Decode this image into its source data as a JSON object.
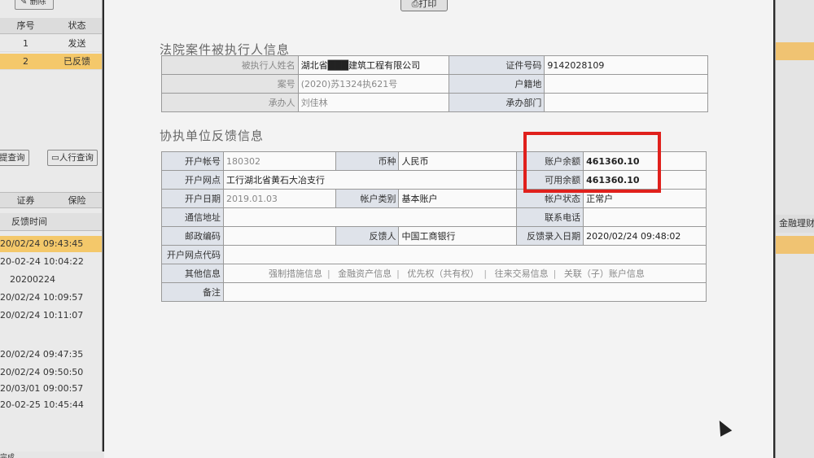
{
  "left": {
    "top_button": "删除",
    "grid_headers": [
      "序号",
      "状态"
    ],
    "grid_rows": [
      {
        "no": "1",
        "status": "发送"
      },
      {
        "no": "2",
        "status": "已反馈"
      }
    ],
    "query_buttons": [
      "提查询",
      "人行查询"
    ],
    "tabs": [
      "证券",
      "保险"
    ],
    "feedback_header": "反馈时间",
    "times": [
      "20/02/24 09:43:45",
      "20-02-24 10:04:22",
      "20200224",
      "20/02/24 10:09:57",
      "20/02/24 10:11:07",
      "20/02/24 09:47:35",
      "20/02/24 09:50:50",
      "20/03/01 09:00:57",
      "20-02-25 10:45:44"
    ]
  },
  "right": {
    "header": "金融理财"
  },
  "toolbar": {
    "print_label": "打印"
  },
  "section1": {
    "title": "法院案件被执行人信息",
    "name_label": "被执行人姓名",
    "name_value": "湖北省███建筑工程有限公司",
    "cert_label": "证件号码",
    "cert_value": "9142028109",
    "case_label": "案号",
    "case_value": "(2020)苏1324执621号",
    "household_label": "户籍地",
    "household_value": "",
    "handler_label": "承办人",
    "handler_value": "刘佳林",
    "dept_label": "承办部门",
    "dept_value": ""
  },
  "section2": {
    "title": "协执单位反馈信息",
    "account_no_label": "开户帐号",
    "account_no_value": "180302",
    "currency_label": "币种",
    "currency_value": "人民币",
    "balance_label": "账户余额",
    "balance_value": "461360.10",
    "branch_label": "开户网点",
    "branch_value": "工行湖北省黄石大冶支行",
    "available_label": "可用余额",
    "available_value": "461360.10",
    "open_date_label": "开户日期",
    "open_date_value": "2019.01.03",
    "account_type_label": "帐户类别",
    "account_type_value": "基本账户",
    "account_status_label": "帐户状态",
    "account_status_value": "正常户",
    "address_label": "通信地址",
    "address_value": "",
    "phone_label": "联系电话",
    "phone_value": "",
    "postal_label": "邮政编码",
    "postal_value": "",
    "feedback_person_label": "反馈人",
    "feedback_person_value": "中国工商银行",
    "entry_date_label": "反馈录入日期",
    "entry_date_value": "2020/02/24 09:48:02",
    "branch_code_label": "开户网点代码",
    "branch_code_value": "",
    "other_label": "其他信息",
    "other_links": [
      "强制措施信息",
      "金融资产信息",
      "优先权（共有权）",
      "往来交易信息",
      "关联（子）账户信息"
    ],
    "remark_label": "备注",
    "remark_value": ""
  },
  "status_bar": {
    "text": "完成"
  },
  "colors": {
    "highlight": "#e0201c",
    "balance_text": "#d22a2a",
    "selected_row": "#f4c86a"
  }
}
